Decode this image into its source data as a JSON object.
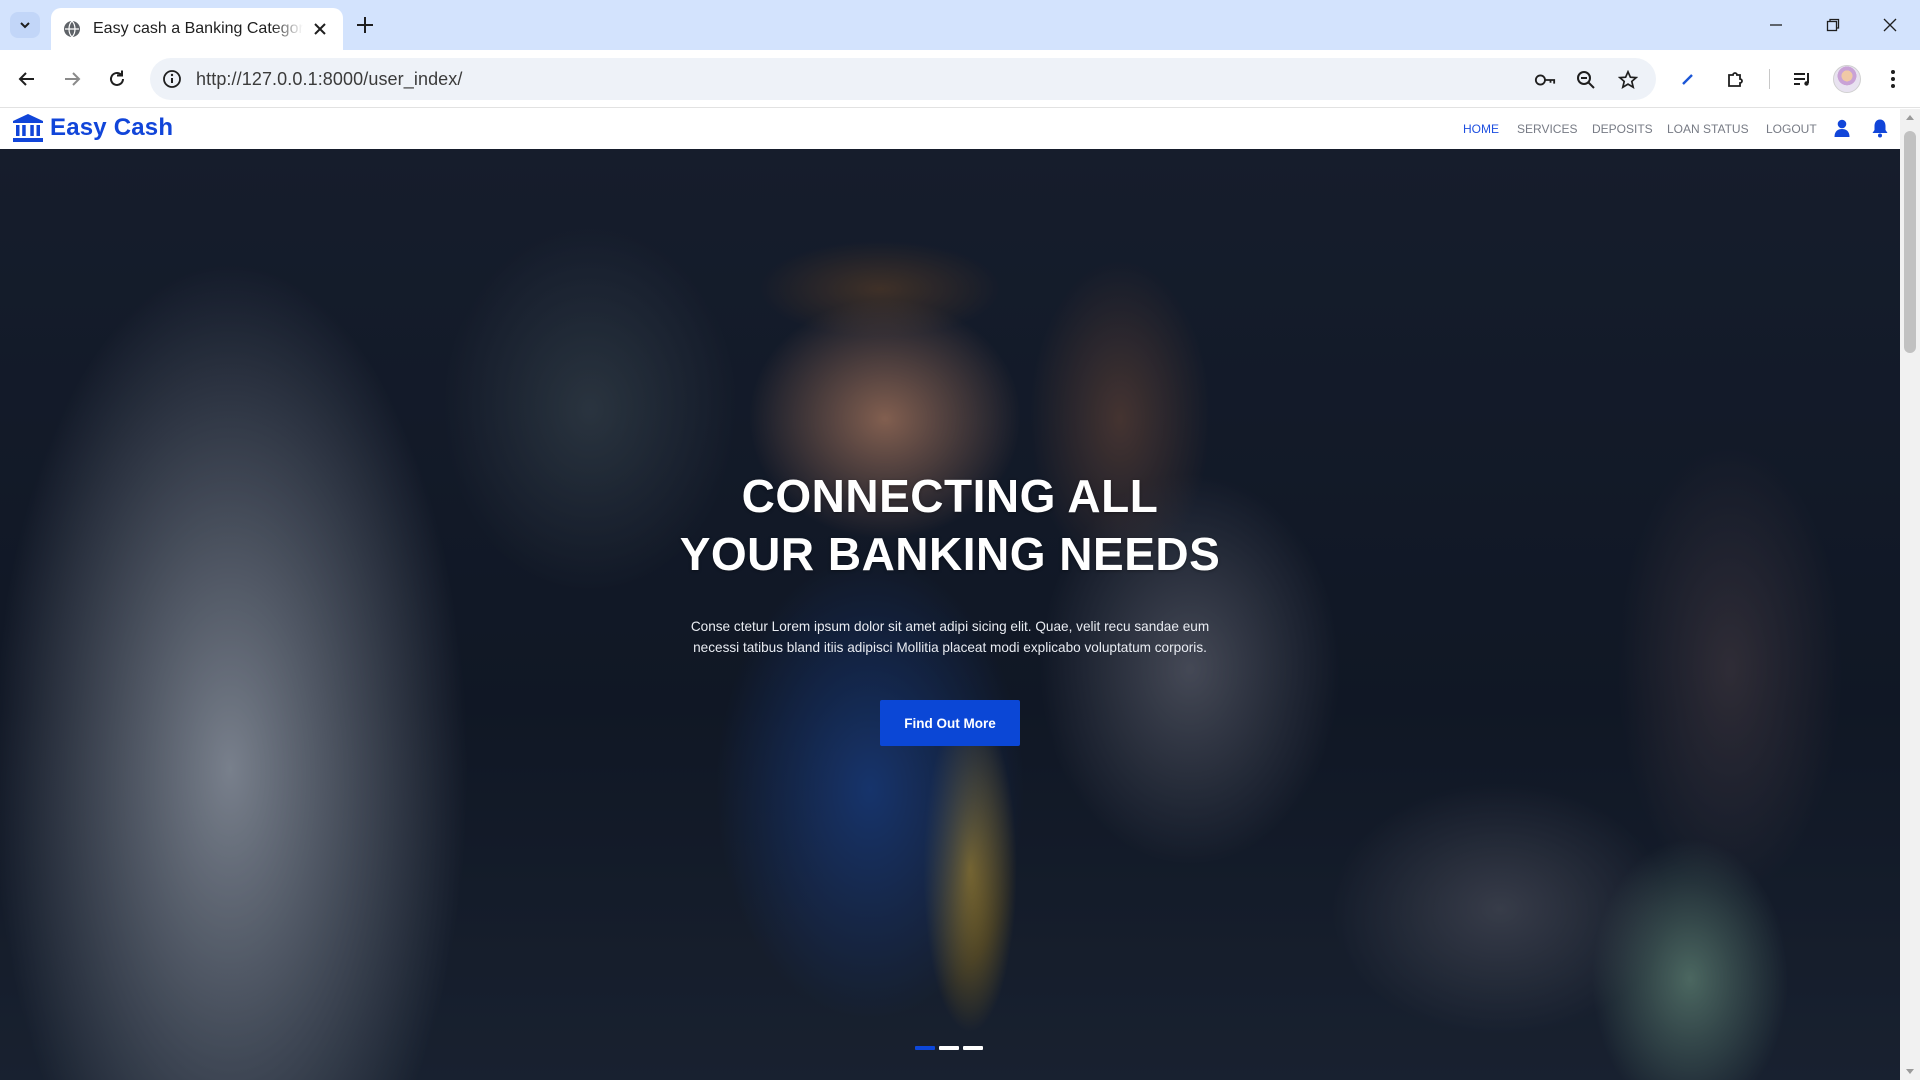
{
  "browser": {
    "tab_title": "Easy cash a Banking Category R",
    "url": "http://127.0.0.1:8000/user_index/"
  },
  "site": {
    "brand": "Easy Cash",
    "brand_color": "#1145d9",
    "accent_color": "#0b47d6",
    "menu": [
      {
        "label": "HOME",
        "active": true
      },
      {
        "label": "SERVICES",
        "active": false
      },
      {
        "label": "DEPOSITS",
        "active": false
      },
      {
        "label": "LOAN STATUS",
        "active": false
      },
      {
        "label": "LOGOUT",
        "active": false
      }
    ],
    "icons": [
      "user-icon",
      "bell-icon"
    ]
  },
  "hero": {
    "title_line1": "CONNECTING ALL",
    "title_line2": "YOUR BANKING NEEDS",
    "text_line1": "Conse ctetur Lorem ipsum dolor sit amet adipi sicing elit. Quae, velit recu sandae eum",
    "text_line2": "necessi tatibus bland itiis adipisci Mollitia placeat modi explicabo voluptatum corporis.",
    "button_label": "Find Out More",
    "slides_total": 3,
    "active_slide": 1
  }
}
